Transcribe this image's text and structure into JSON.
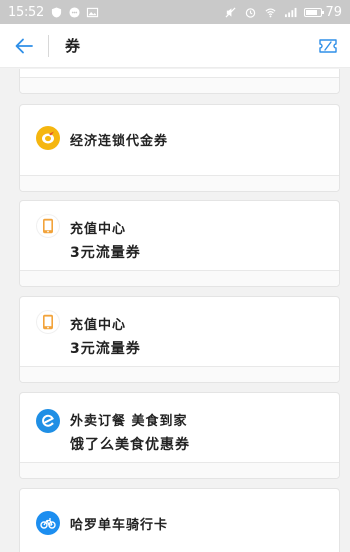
{
  "status_bar": {
    "time": "15:52",
    "battery": "79",
    "battery_level": 0.79
  },
  "header": {
    "title": "券"
  },
  "coupons": [
    {
      "title": "经济连锁代金券",
      "subtitle": ""
    },
    {
      "title": "充值中心",
      "subtitle": "3元流量券"
    },
    {
      "title": "充值中心",
      "subtitle": "3元流量券"
    },
    {
      "title": "外卖订餐 美食到家",
      "subtitle": "饿了么美食优惠券"
    },
    {
      "title": "哈罗单车骑行卡",
      "subtitle": ""
    }
  ],
  "colors": {
    "accent": "#2f8fe8",
    "status_bar_bg": "#c9c9c9",
    "hotel_icon": "#f5b60f",
    "recharge_icon": "#f2a33a",
    "eleme_icon": "#1f8fe5",
    "hellobike_icon": "#1c8ef0"
  }
}
